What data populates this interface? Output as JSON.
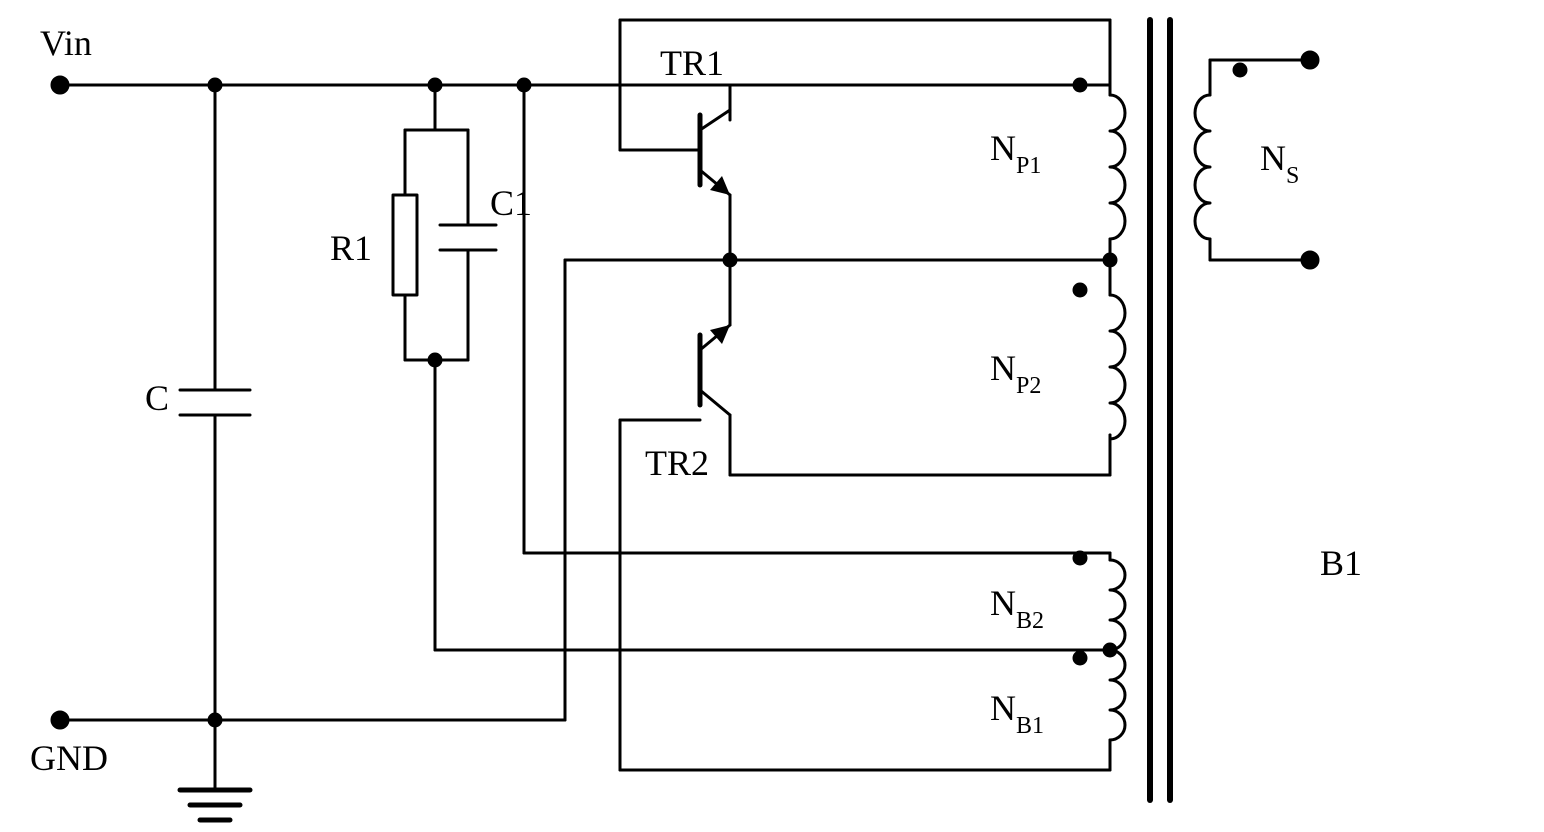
{
  "labels": {
    "vin": "Vin",
    "gnd": "GND",
    "c": "C",
    "r1": "R1",
    "c1": "C1",
    "tr1": "TR1",
    "tr2": "TR2",
    "b1": "B1",
    "np1_base": "N",
    "np1_sub": "P1",
    "np2_base": "N",
    "np2_sub": "P2",
    "nb1_base": "N",
    "nb1_sub": "B1",
    "nb2_base": "N",
    "nb2_sub": "B2",
    "ns_base": "N",
    "ns_sub": "S"
  }
}
